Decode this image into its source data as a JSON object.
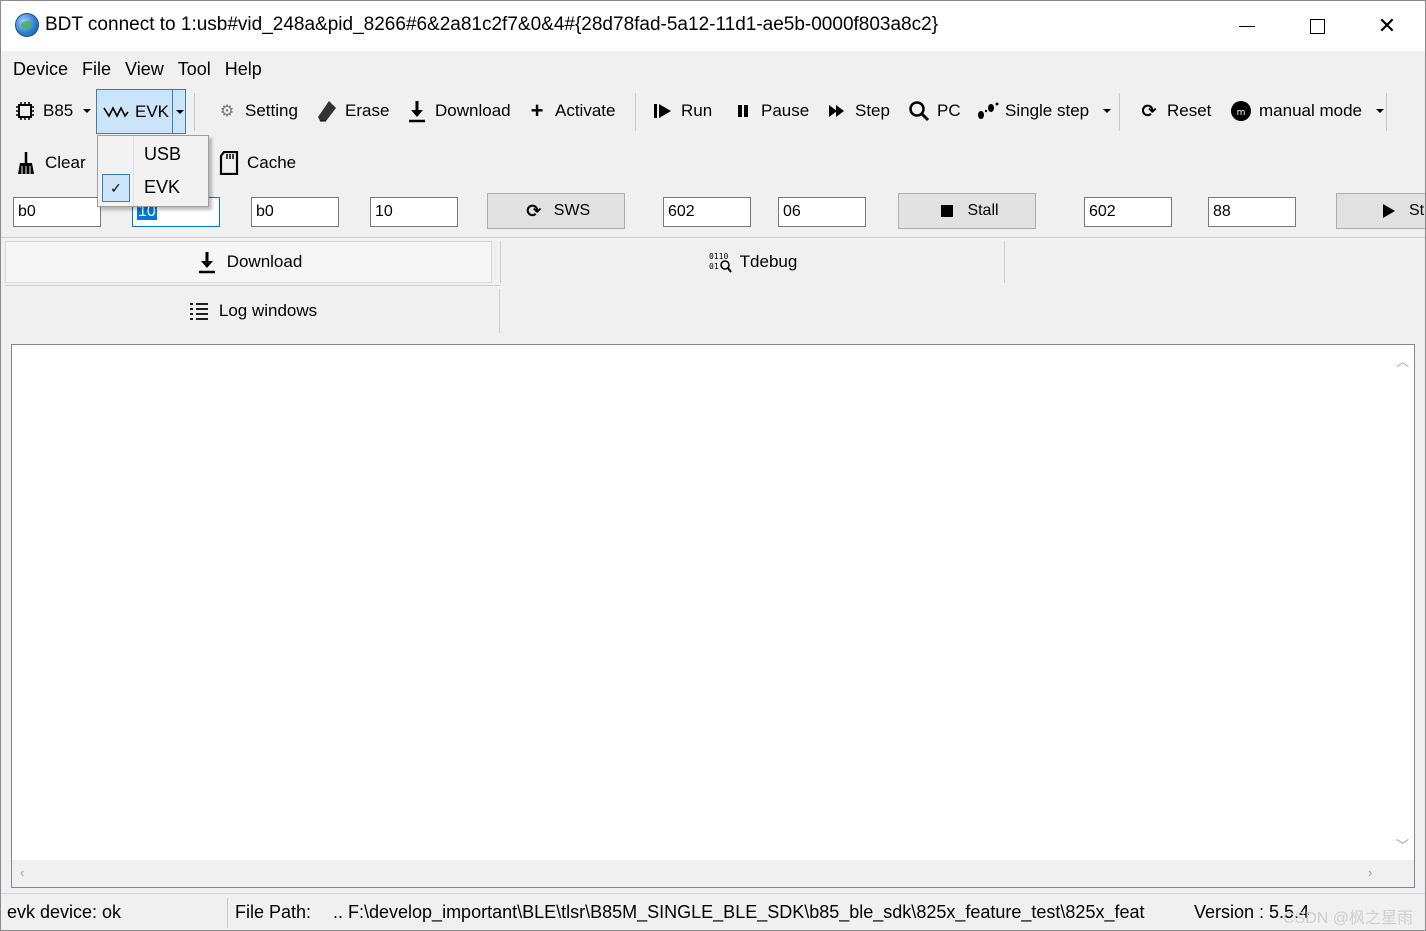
{
  "window": {
    "title": "BDT connect to 1:usb#vid_248a&pid_8266#6&2a81c2f7&0&4#{28d78fad-5a12-11d1-ae5b-0000f803a8c2}"
  },
  "menubar": [
    "Device",
    "File",
    "View",
    "Tool",
    "Help"
  ],
  "toolbar": {
    "chip": "B85",
    "interface": "EVK",
    "setting": "Setting",
    "erase": "Erase",
    "download": "Download",
    "activate": "Activate",
    "run": "Run",
    "pause": "Pause",
    "step": "Step",
    "pc": "PC",
    "single_step": "Single step",
    "reset": "Reset",
    "mode": "manual mode",
    "clear": "Clear",
    "cache": "Cache"
  },
  "interface_menu": {
    "items": [
      "USB",
      "EVK"
    ],
    "checked": "EVK"
  },
  "fields": {
    "f1": "b0",
    "f2": "10",
    "f3": "b0",
    "f4": "10",
    "sws_label": "SWS",
    "f5": "602",
    "f6": "06",
    "stall_label": "Stall",
    "f7": "602",
    "f8": "88",
    "start_label": "St"
  },
  "tabs": {
    "download": "Download",
    "tdebug": "Tdebug",
    "log": "Log windows"
  },
  "status": {
    "device": "evk device: ok",
    "file_path_label": "File Path:",
    "file_path": "..  F:\\develop_important\\BLE\\tlsr\\B85M_SINGLE_BLE_SDK\\b85_ble_sdk\\825x_feature_test\\825x_feat",
    "version": "Version : 5.5.4",
    "watermark": "CSDN @枫之星雨"
  }
}
